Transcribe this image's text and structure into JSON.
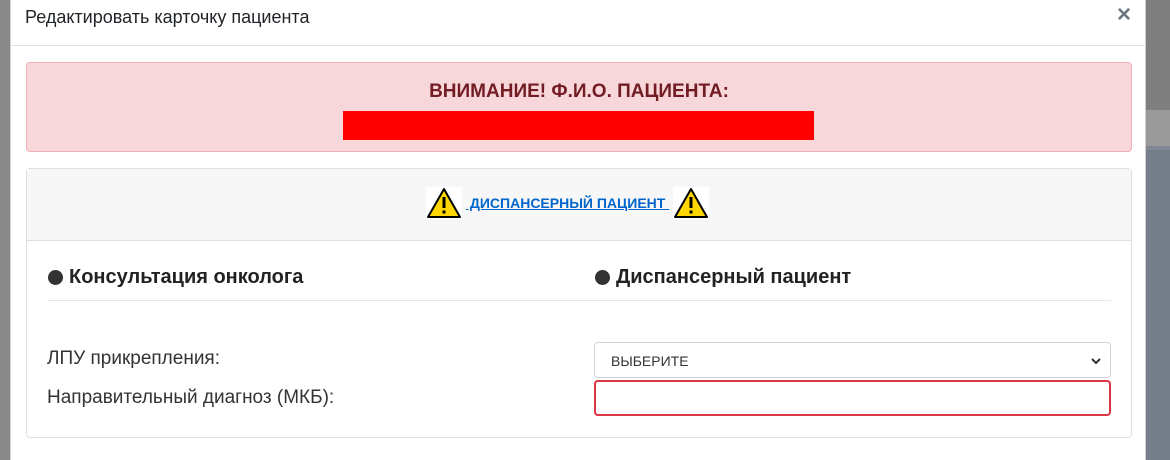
{
  "modal": {
    "title": "Редактировать карточку пациента",
    "close_symbol": "×"
  },
  "alert": {
    "title": "ВНИМАНИЕ! Ф.И.О. ПАЦИЕНТА:",
    "bg_color": "#f8d7da",
    "text_color": "#721c24",
    "redaction_color": "#ff0000"
  },
  "card": {
    "header_link": " ДИСПАНСЕРНЫЙ ПАЦИЕНТ ",
    "left_icon": "warning-icon",
    "right_icon": "warning-icon",
    "sections": [
      {
        "label": "Консультация онколога"
      },
      {
        "label": "Диспансерный пациент"
      }
    ]
  },
  "form": {
    "lpu_label": "ЛПУ прикрепления:",
    "lpu_select_value": "ВЫБЕРИТЕ",
    "diagnosis_label": "Направительный диагноз (МКБ):",
    "diagnosis_value": "",
    "invalid_border_color": "#dc3545"
  }
}
